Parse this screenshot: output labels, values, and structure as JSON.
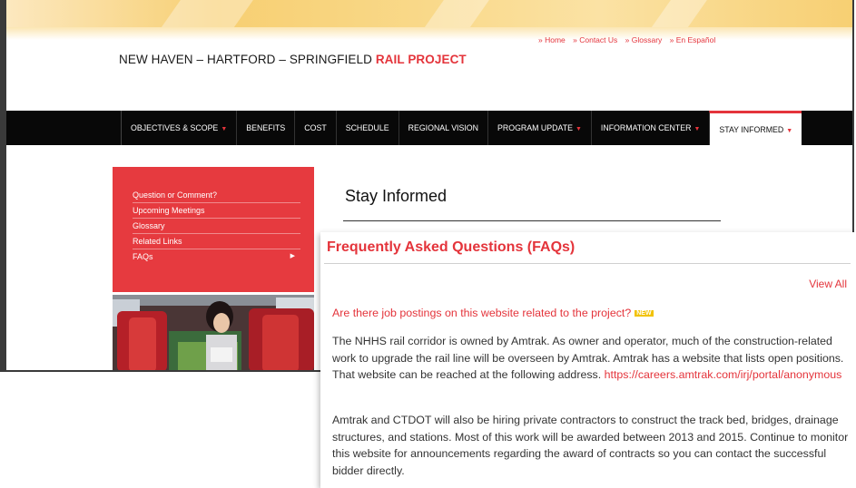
{
  "site": {
    "title_main": "NEW HAVEN – HARTFORD – SPRINGFIELD",
    "title_accent": "RAIL PROJECT",
    "utility_links": [
      "» Home",
      "» Contact Us",
      "» Glossary",
      "» En Español"
    ]
  },
  "nav": {
    "items": [
      {
        "label": "OBJECTIVES & SCOPE",
        "dropdown": true
      },
      {
        "label": "BENEFITS",
        "dropdown": false
      },
      {
        "label": "COST",
        "dropdown": false
      },
      {
        "label": "SCHEDULE",
        "dropdown": false
      },
      {
        "label": "REGIONAL VISION",
        "dropdown": false
      },
      {
        "label": "PROGRAM UPDATE",
        "dropdown": true
      },
      {
        "label": "INFORMATION CENTER",
        "dropdown": true
      },
      {
        "label": "STAY INFORMED",
        "dropdown": true,
        "active": true
      }
    ],
    "caret": "▼"
  },
  "sidebar": {
    "items": [
      "Question or Comment?",
      "Upcoming Meetings",
      "Glossary",
      "Related Links",
      "FAQs"
    ],
    "faq_arrow": "▶"
  },
  "main": {
    "heading": "Stay Informed"
  },
  "faq": {
    "title": "Frequently Asked Questions (FAQs)",
    "view_all": "View All",
    "question": "Are there job postings on this website related to the project?",
    "badge": "NEW",
    "answer_1": "The NHHS rail corridor is owned by Amtrak.  As owner and operator, much of the construction-related work to upgrade the rail line will be overseen by Amtrak. Amtrak has a website that lists open positions.  That website can be reached at the following address.",
    "answer_link": "https://careers.amtrak.com/irj/portal/anonymous",
    "answer_2": "Amtrak and CTDOT will also be hiring private contractors to construct the track bed, bridges, drainage structures, and stations.  Most of this work will be awarded between 2013 and 2015.  Continue to monitor this website for announcements regarding the award of contracts so you can contact the successful bidder directly."
  },
  "colors": {
    "accent": "#e4343b",
    "nav_bg": "#080808",
    "sidebar_bg": "#e63a3f",
    "badge": "#f2c200"
  }
}
